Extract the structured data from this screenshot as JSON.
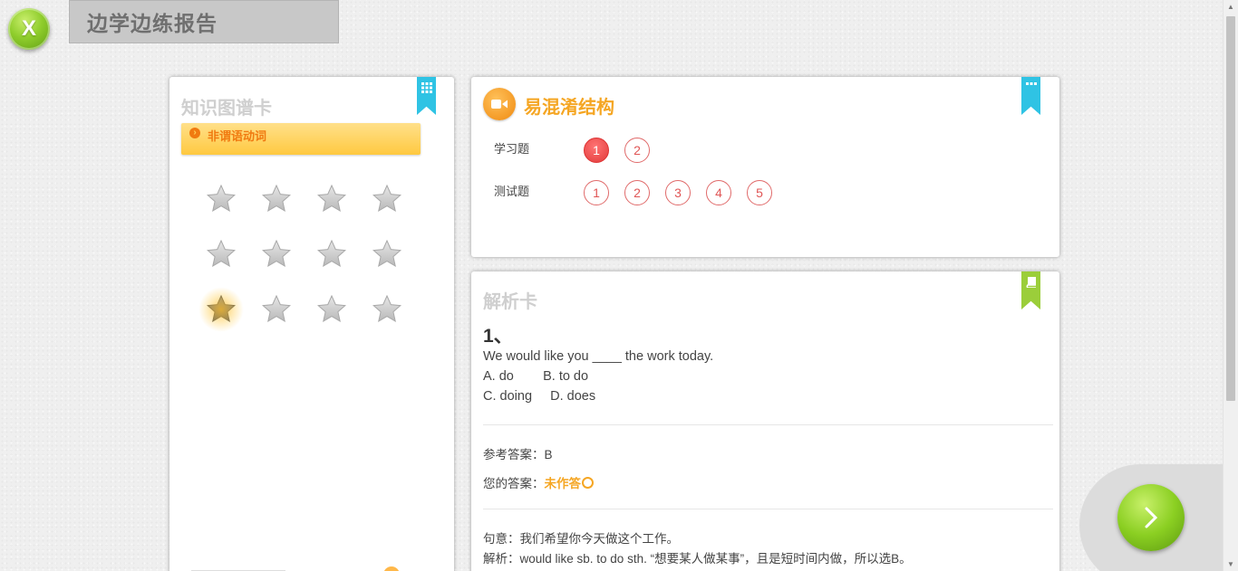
{
  "app": {
    "logo_letter": "X",
    "title": "边学边练报告"
  },
  "knowledge_card": {
    "title": "知识图谱卡",
    "topic": "非谓语动词",
    "ribbon_icon": "grid-icon",
    "stars_total": 12,
    "active_star_index": 8
  },
  "structure_card": {
    "title": "易混淆结构",
    "ribbon_icon": "more-icon",
    "study_label": "学习题",
    "test_label": "测试题",
    "study_questions": [
      "1",
      "2"
    ],
    "test_questions": [
      "1",
      "2",
      "3",
      "4",
      "5"
    ],
    "selected_study": 0
  },
  "analysis_card": {
    "title": "解析卡",
    "ribbon_icon": "book-icon",
    "question_number": "1、",
    "question_text": "We would like you ____ the work today.",
    "options_line1": "A. do        B. to do",
    "options_line2": "C. doing     D. does",
    "reference_label": "参考答案：",
    "reference_answer": "B",
    "your_label": "您的答案：",
    "your_answer": "未作答",
    "meaning": "句意：我们希望你今天做这个工作。",
    "explanation": "解析：would like sb. to do sth. “想要某人做某事”，且是短时间内做，所以选B。"
  },
  "colors": {
    "accent_orange": "#f5a623",
    "ribbon_blue": "#2fc3e4",
    "ribbon_green": "#9bce3a",
    "selected_red": "#e23a3a"
  }
}
